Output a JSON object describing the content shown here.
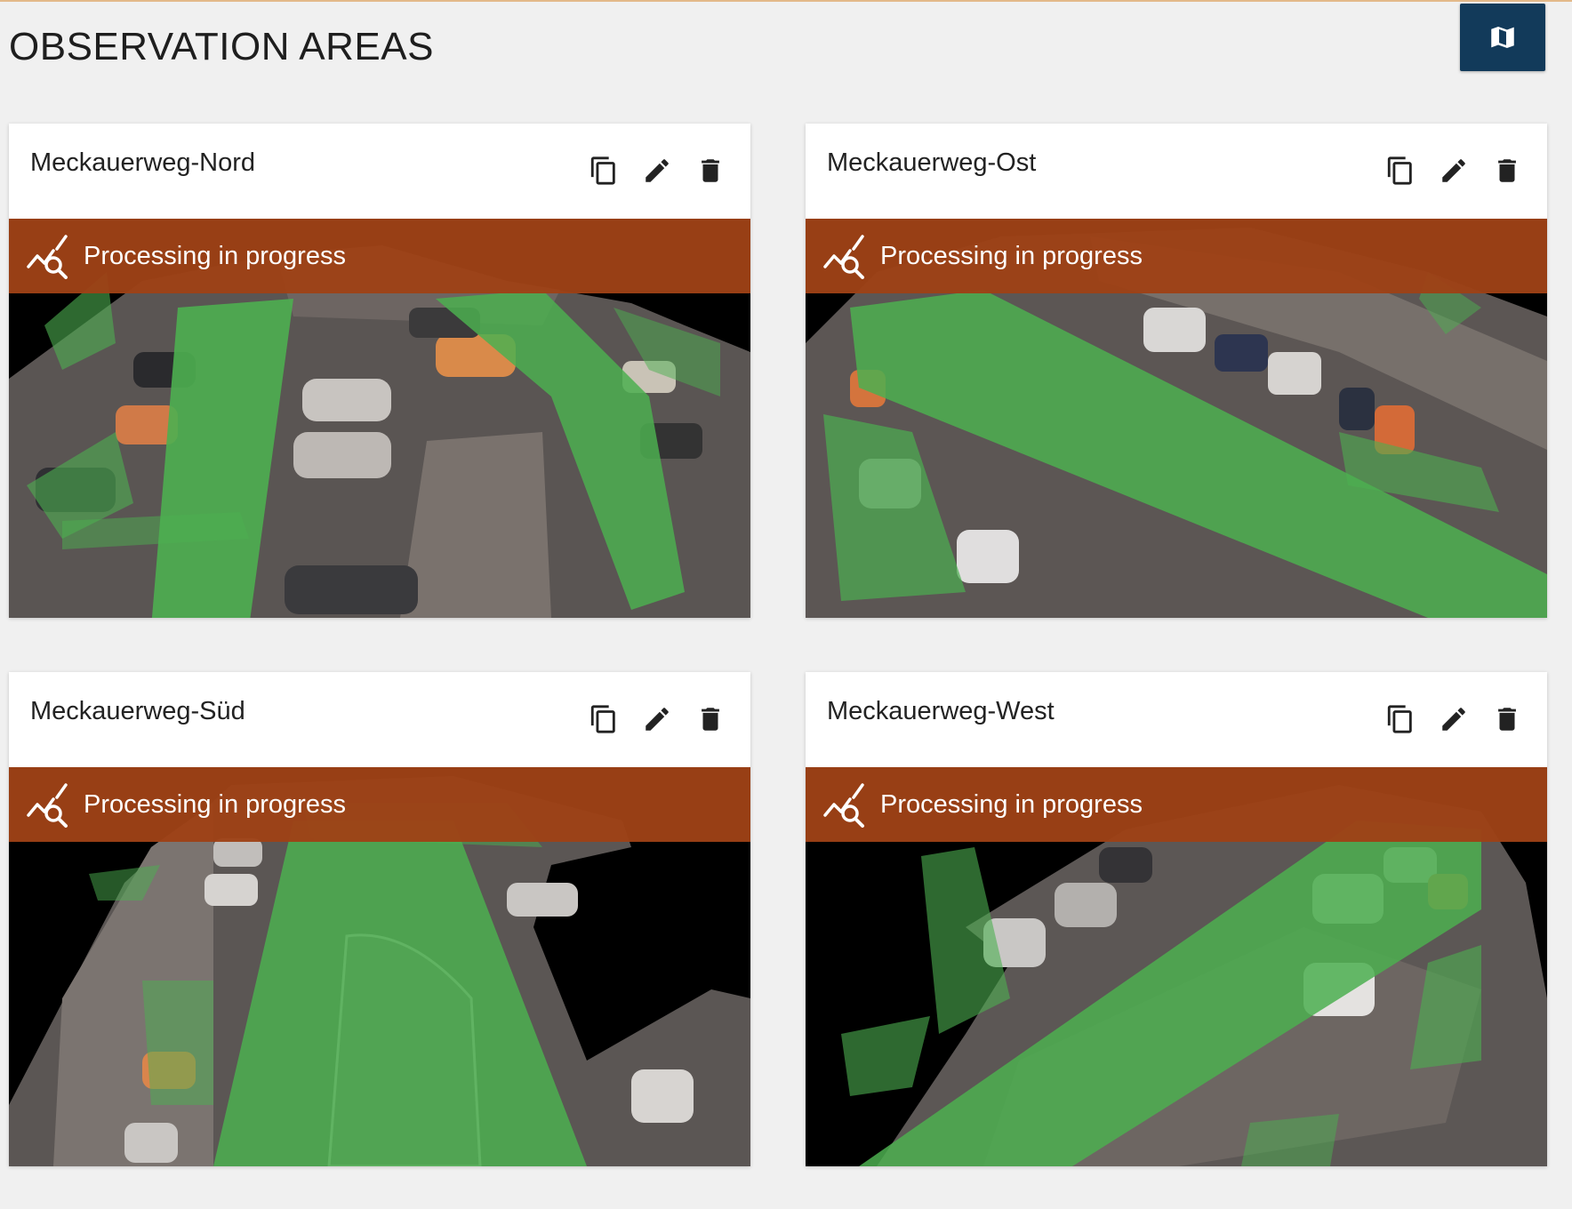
{
  "page": {
    "title": "OBSERVATION AREAS"
  },
  "toolbar": {
    "map_icon": "map-icon",
    "accent_color": "#123a5a"
  },
  "cards": [
    {
      "name": "Meckauerweg-Nord",
      "status": "Processing in progress",
      "actions": [
        "copy-icon",
        "edit-icon",
        "delete-icon"
      ]
    },
    {
      "name": "Meckauerweg-Ost",
      "status": "Processing in progress",
      "actions": [
        "copy-icon",
        "edit-icon",
        "delete-icon"
      ]
    },
    {
      "name": "Meckauerweg-Süd",
      "status": "Processing in progress",
      "actions": [
        "copy-icon",
        "edit-icon",
        "delete-icon"
      ]
    },
    {
      "name": "Meckauerweg-West",
      "status": "Processing in progress",
      "actions": [
        "copy-icon",
        "edit-icon",
        "delete-icon"
      ]
    }
  ],
  "colors": {
    "status_banner": "#9e4216",
    "trajectory_overlay": "#4caf50",
    "background": "#f0f0f0"
  }
}
